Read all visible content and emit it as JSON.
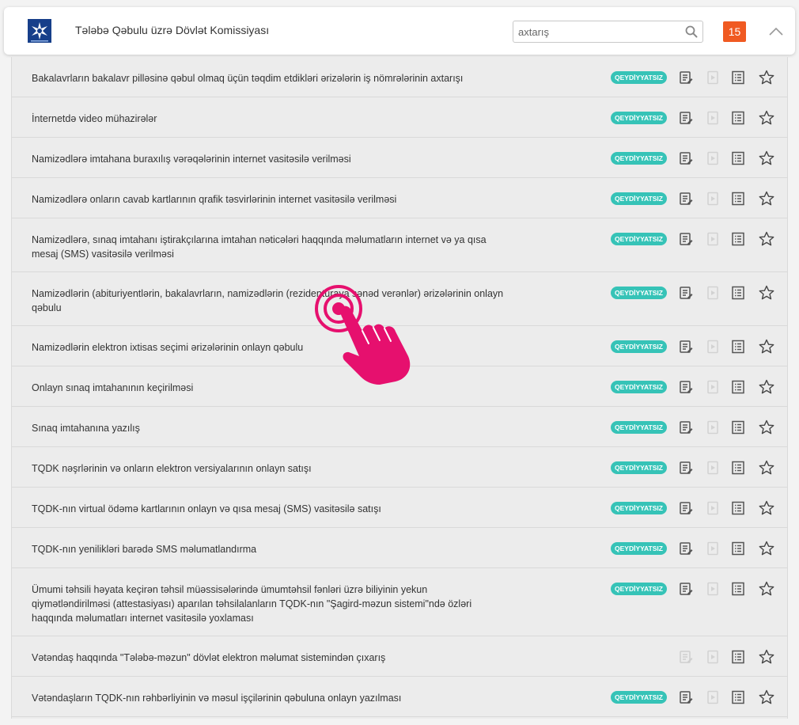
{
  "header": {
    "title": "Tələbə Qəbulu üzrə Dövlət Komissiyası",
    "search_placeholder": "axtarış",
    "count": "15",
    "logo_icon": "tqdk-logo-icon",
    "search_icon": "search-icon",
    "collapse_icon": "chevron-up-icon"
  },
  "colors": {
    "badge": "#36c3b7",
    "count_badge": "#f05a22",
    "cursor": "#e6106e",
    "logo": "#173f8a"
  },
  "services": [
    {
      "title": "Bakalavrların bakalavr pilləsinə qəbul olmaq üçün təqdim etdikləri ərizələrin iş nömrələrinin axtarışı",
      "badge": "QEYDİYYATSIZ"
    },
    {
      "title": "İnternetdə video mühazirələr",
      "badge": "QEYDİYYATSIZ"
    },
    {
      "title": "Namizədlərə imtahana buraxılış vərəqələrinin internet vasitəsilə verilməsi",
      "badge": "QEYDİYYATSIZ"
    },
    {
      "title": "Namizədlərə onların cavab kartlarının qrafik təsvirlərinin internet vasitəsilə verilməsi",
      "badge": "QEYDİYYATSIZ"
    },
    {
      "title": "Namizədlərə, sınaq imtahanı iştirakçılarına imtahan nəticələri haqqında məlumatların internet və ya qısa mesaj (SMS) vasitəsilə verilməsi",
      "badge": "QEYDİYYATSIZ"
    },
    {
      "title": "Namizədlərin (abituriyentlərin, bakalavrların, namizədlərin (rezidenturaya sənəd verənlər) ərizələrinin onlayn qəbulu",
      "badge": "QEYDİYYATSIZ"
    },
    {
      "title": "Namizədlərin elektron ixtisas seçimi ərizələrinin onlayn qəbulu",
      "badge": "QEYDİYYATSIZ"
    },
    {
      "title": "Onlayn sınaq imtahanının keçirilməsi",
      "badge": "QEYDİYYATSIZ"
    },
    {
      "title": "Sınaq imtahanına yazılış",
      "badge": "QEYDİYYATSIZ"
    },
    {
      "title": "TQDK nəşrlərinin və onların elektron versiyalarının onlayn satışı",
      "badge": "QEYDİYYATSIZ"
    },
    {
      "title": "TQDK-nın virtual ödəmə kartlarının onlayn və qısa mesaj (SMS) vasitəsilə satışı",
      "badge": "QEYDİYYATSIZ"
    },
    {
      "title": "TQDK-nın yenilikləri barədə SMS məlumatlandırma",
      "badge": "QEYDİYYATSIZ"
    },
    {
      "title": "Ümumi təhsili həyata keçirən təhsil müəssisələrində ümumtəhsil fənləri üzrə biliyinin yekun qiymətləndirilməsi (attestasiyası) aparılan təhsilalanların TQDK-nın \"Şagird-məzun sistemi\"ndə özləri haqqında məlumatları internet vasitəsilə yoxlaması",
      "badge": "QEYDİYYATSIZ"
    },
    {
      "title": "Vətəndaş haqqında \"Tələbə-məzun\" dövlət elektron məlumat sistemindən çıxarış",
      "badge": ""
    },
    {
      "title": "Vətəndaşların TQDK-nın rəhbərliyinin və məsul işçilərinin qəbuluna onlayn yazılması",
      "badge": "QEYDİYYATSIZ"
    }
  ]
}
